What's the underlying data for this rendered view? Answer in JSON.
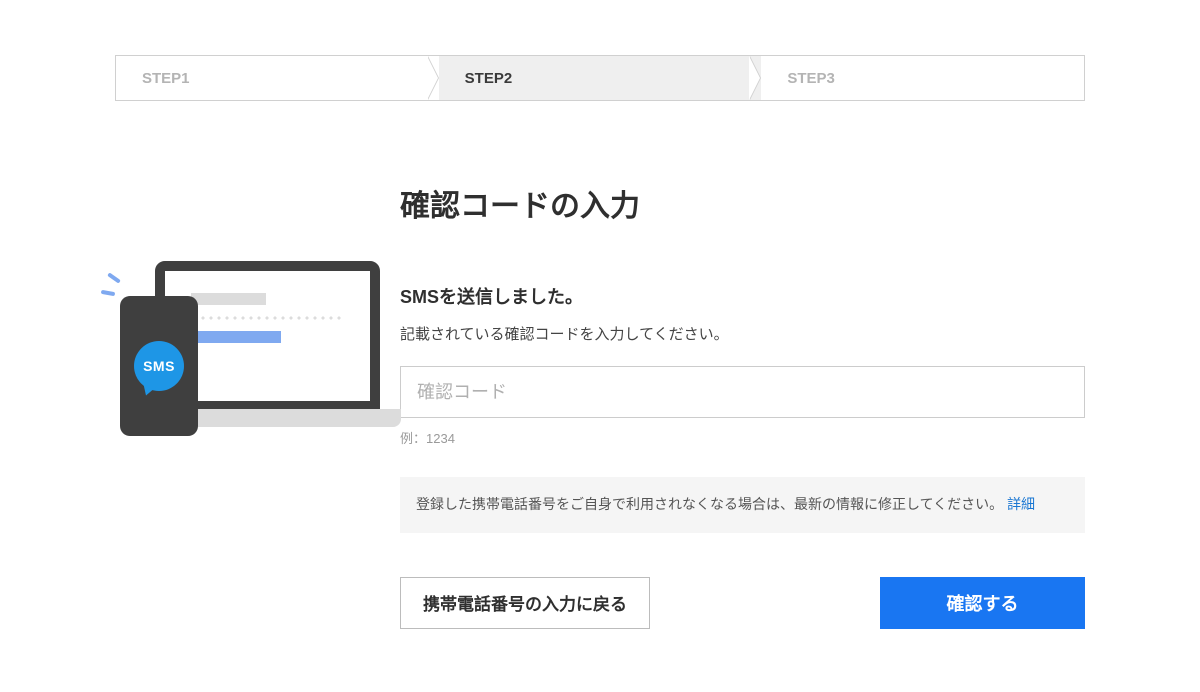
{
  "steps": {
    "step1": "STEP1",
    "step2": "STEP2",
    "step3": "STEP3",
    "active_index": 1
  },
  "illustration": {
    "sms_label": "SMS"
  },
  "content": {
    "title": "確認コードの入力",
    "subtitle": "SMSを送信しました。",
    "description": "記載されている確認コードを入力してください。",
    "input_placeholder": "確認コード",
    "input_value": "",
    "example": "例：1234",
    "note_text": "登録した携帯電話番号をご自身で利用されなくなる場合は、最新の情報に修正してください。",
    "note_link": "詳細"
  },
  "buttons": {
    "back": "携帯電話番号の入力に戻る",
    "confirm": "確認する"
  }
}
